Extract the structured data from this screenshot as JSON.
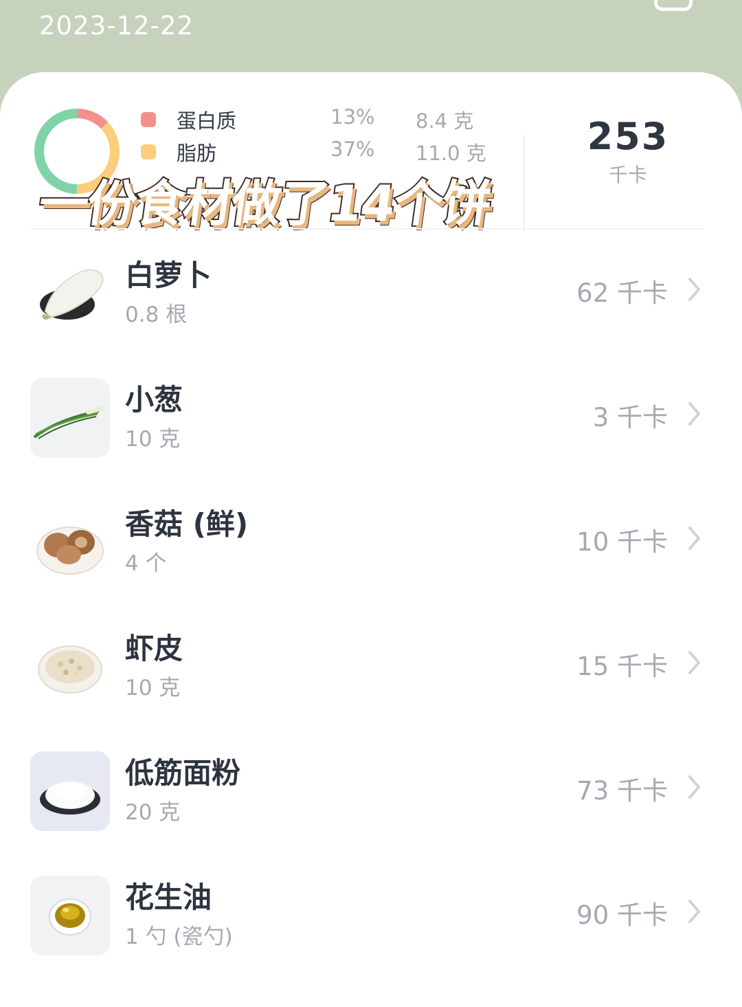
{
  "header": {
    "date": "2023-12-22"
  },
  "summary": {
    "macros": [
      {
        "name": "蛋白质",
        "percent": "13%",
        "amount": "8.4 克",
        "color": "#f4908b",
        "share": 0.13
      },
      {
        "name": "脂肪",
        "percent": "37%",
        "amount": "11.0 克",
        "color": "#fbcd7c",
        "share": 0.37
      },
      {
        "color": "#7fd3a8",
        "share": 0.5
      }
    ],
    "total_value": "253",
    "total_unit": "千卡"
  },
  "overlay_title": "一份食材做了14个饼",
  "items": [
    {
      "name": "白萝卜",
      "quantity": "0.8 根",
      "calories": "62 千卡",
      "icon": "white-radish-icon"
    },
    {
      "name": "小葱",
      "quantity": "10 克",
      "calories": "3 千卡",
      "icon": "scallion-icon"
    },
    {
      "name": "香菇 (鲜)",
      "quantity": "4 个",
      "calories": "10 千卡",
      "icon": "shiitake-mushroom-icon"
    },
    {
      "name": "虾皮",
      "quantity": "10 克",
      "calories": "15 千卡",
      "icon": "dried-shrimp-icon"
    },
    {
      "name": "低筋面粉",
      "quantity": "20 克",
      "calories": "73 千卡",
      "icon": "flour-icon"
    },
    {
      "name": "花生油",
      "quantity": "1 勺 (瓷勺)",
      "calories": "90 千卡",
      "icon": "peanut-oil-icon"
    }
  ]
}
